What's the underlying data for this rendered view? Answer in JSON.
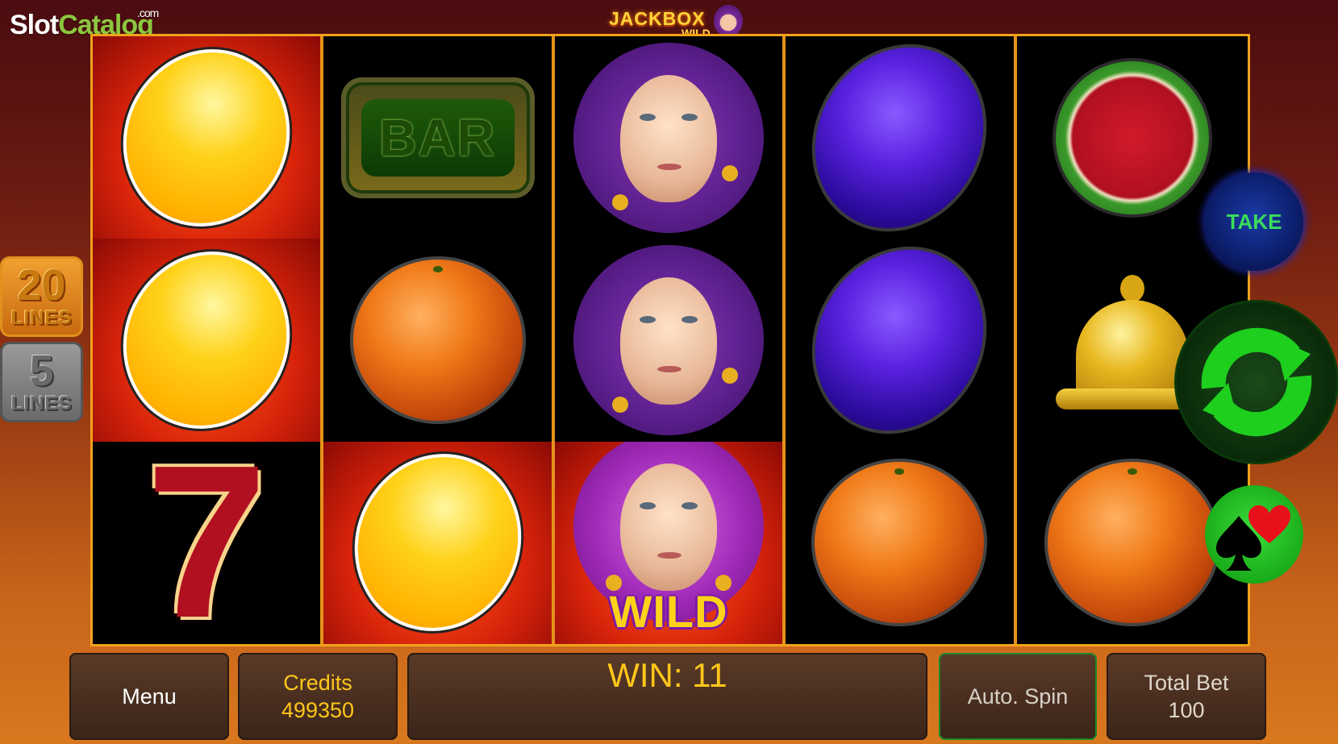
{
  "watermark": {
    "part1": "Slot",
    "part2": "Catalog",
    "com": ".com"
  },
  "logo": {
    "line1": "JACKBOX",
    "line2": "WILD"
  },
  "lines": [
    {
      "number": "20",
      "label": "LINES"
    },
    {
      "number": "5",
      "label": "LINES"
    }
  ],
  "reels": [
    [
      "lemon-fire",
      "lemon-fire",
      "seven"
    ],
    [
      "bar",
      "orange",
      "lemon-fire"
    ],
    [
      "jester",
      "jester",
      "jester-wild"
    ],
    [
      "plum",
      "plum",
      "orange"
    ],
    [
      "watermelon",
      "bell",
      "orange"
    ]
  ],
  "symbols": {
    "bar_text": "BAR",
    "wild_text": "WILD"
  },
  "buttons": {
    "take": "TAKE",
    "spin_icon": "refresh-arrows-icon",
    "gamble_icon": "card-suits-icon"
  },
  "bottom": {
    "menu": "Menu",
    "credits_label": "Credits",
    "credits_value": "499350",
    "win": "WIN: 11",
    "autospin": "Auto. Spin",
    "totalbet_label": "Total Bet",
    "totalbet_value": "100"
  },
  "colors": {
    "accent": "#ffc61a",
    "frame": "#f0a21c",
    "spin": "#1ecf1e",
    "take_text": "#3adc5a"
  }
}
